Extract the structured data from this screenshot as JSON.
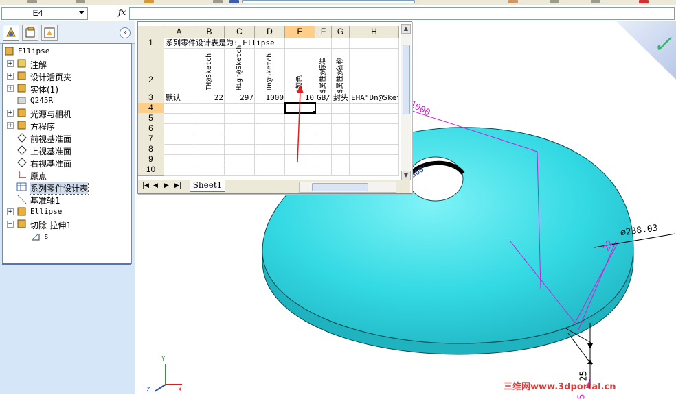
{
  "formula_bar": {
    "name_box": "E4",
    "fx": "fx",
    "formula": ""
  },
  "feature_tree": {
    "items": [
      {
        "label": "Ellipse",
        "icon": "part-icon",
        "mono": true
      },
      {
        "label": "注解",
        "icon": "annotation-icon"
      },
      {
        "label": "设计活页夹",
        "icon": "design-binder-icon"
      },
      {
        "label": "实体(1)",
        "icon": "solid-bodies-icon"
      },
      {
        "label": "Q245R",
        "icon": "material-icon",
        "mono": true
      },
      {
        "label": "光源与相机",
        "icon": "lights-cameras-icon"
      },
      {
        "label": "方程序",
        "icon": "equations-icon"
      },
      {
        "label": "前视基准面",
        "icon": "plane-icon"
      },
      {
        "label": "上视基准面",
        "icon": "plane-icon"
      },
      {
        "label": "右视基准面",
        "icon": "plane-icon"
      },
      {
        "label": "原点",
        "icon": "origin-icon"
      },
      {
        "label": "系列零件设计表",
        "icon": "design-table-icon"
      },
      {
        "label": "基准轴1",
        "icon": "axis-icon"
      },
      {
        "label": "Ellipse",
        "icon": "revolve-icon",
        "mono": true
      },
      {
        "label": "切除-拉伸1",
        "icon": "cut-extrude-icon"
      },
      {
        "label": "s",
        "icon": "sketch-icon",
        "mono": true
      }
    ]
  },
  "spreadsheet": {
    "columns": [
      "A",
      "B",
      "C",
      "D",
      "E",
      "F",
      "G",
      "H"
    ],
    "rows": [
      "1",
      "2",
      "3",
      "4",
      "5",
      "6",
      "7",
      "8",
      "9",
      "10"
    ],
    "title": "系列零件设计表是为: Ellipse",
    "headers_vertical": [
      "TH@Sketch",
      "High@Sketch",
      "Dn@Sketch",
      "$颜色",
      "$属性@标准",
      "$属性@名称"
    ],
    "row3": {
      "a": "默认",
      "b": "22",
      "c": "297",
      "d": "1000",
      "e": "10",
      "f": "GB/T",
      "g": "封头",
      "h": "EHA\"Dn@Sketc"
    },
    "sheet_tab": "Sheet1",
    "active_cell": "E4"
  },
  "viewport": {
    "dim_diameter_top": "⌀1000",
    "dim_diameter_side": "⌀238.03",
    "dim_22": "22",
    "dim_25": "25",
    "dim_5": "5",
    "dim_360": "360°",
    "triad_x": "X",
    "triad_y": "Y",
    "triad_z": "Z",
    "accent": "#33d9e3"
  },
  "watermark": "三维网www.3dportal.cn"
}
